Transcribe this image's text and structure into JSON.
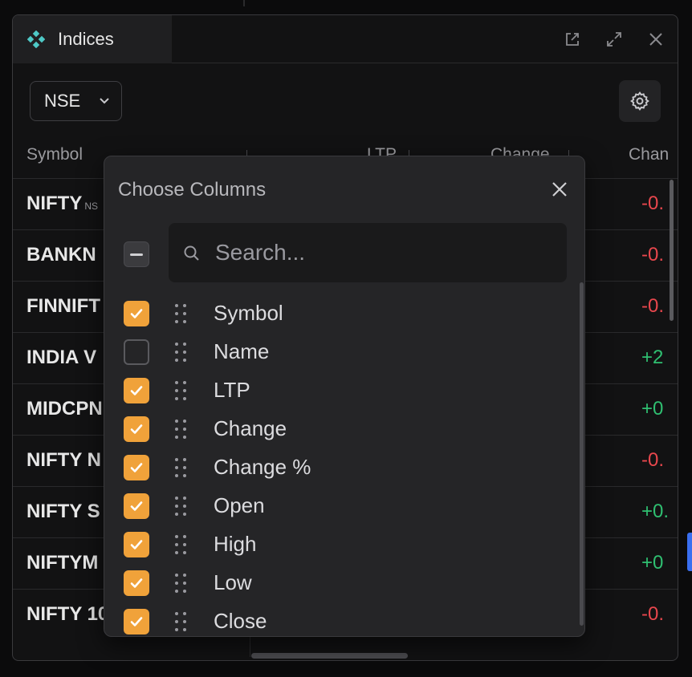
{
  "panel": {
    "title": "Indices",
    "exchange": "NSE"
  },
  "table": {
    "headers": [
      "Symbol",
      "LTP",
      "Change",
      "Chan"
    ],
    "rows": [
      {
        "symbol": "NIFTY",
        "tag": "NS",
        "change": "-0.",
        "direction": "neg"
      },
      {
        "symbol": "BANKN",
        "tag": "",
        "change": "-0.",
        "direction": "neg"
      },
      {
        "symbol": "FINNIFT",
        "tag": "",
        "change": "-0.",
        "direction": "neg"
      },
      {
        "symbol": "INDIA V",
        "tag": "",
        "change": "+2",
        "direction": "pos"
      },
      {
        "symbol": "MIDCPN",
        "tag": "",
        "change": "+0",
        "direction": "pos"
      },
      {
        "symbol": "NIFTY N",
        "tag": "",
        "change": "-0.",
        "direction": "neg"
      },
      {
        "symbol": "NIFTY S",
        "tag": "",
        "change": "+0.",
        "direction": "pos"
      },
      {
        "symbol": "NIFTYM",
        "tag": "",
        "change": "+0",
        "direction": "pos"
      },
      {
        "symbol": "NIFTY 10",
        "tag": "",
        "change": "-0.",
        "direction": "neg"
      }
    ]
  },
  "modal": {
    "title": "Choose Columns",
    "search_placeholder": "Search...",
    "columns": [
      {
        "label": "Symbol",
        "checked": true
      },
      {
        "label": "Name",
        "checked": false
      },
      {
        "label": "LTP",
        "checked": true
      },
      {
        "label": "Change",
        "checked": true
      },
      {
        "label": "Change %",
        "checked": true
      },
      {
        "label": "Open",
        "checked": true
      },
      {
        "label": "High",
        "checked": true
      },
      {
        "label": "Low",
        "checked": true
      },
      {
        "label": "Close",
        "checked": true
      }
    ]
  },
  "colors": {
    "accent": "#f0a23a",
    "negative": "#e8474d",
    "positive": "#2fbf71",
    "brand_icon": "#4ec9c6"
  },
  "icons": {
    "brand": "diamond-cluster-icon",
    "popout": "popout-icon",
    "expand": "expand-icon",
    "close": "close-icon",
    "settings": "gear-icon",
    "search": "search-icon",
    "drag": "drag-handle-icon",
    "check": "check-icon"
  }
}
